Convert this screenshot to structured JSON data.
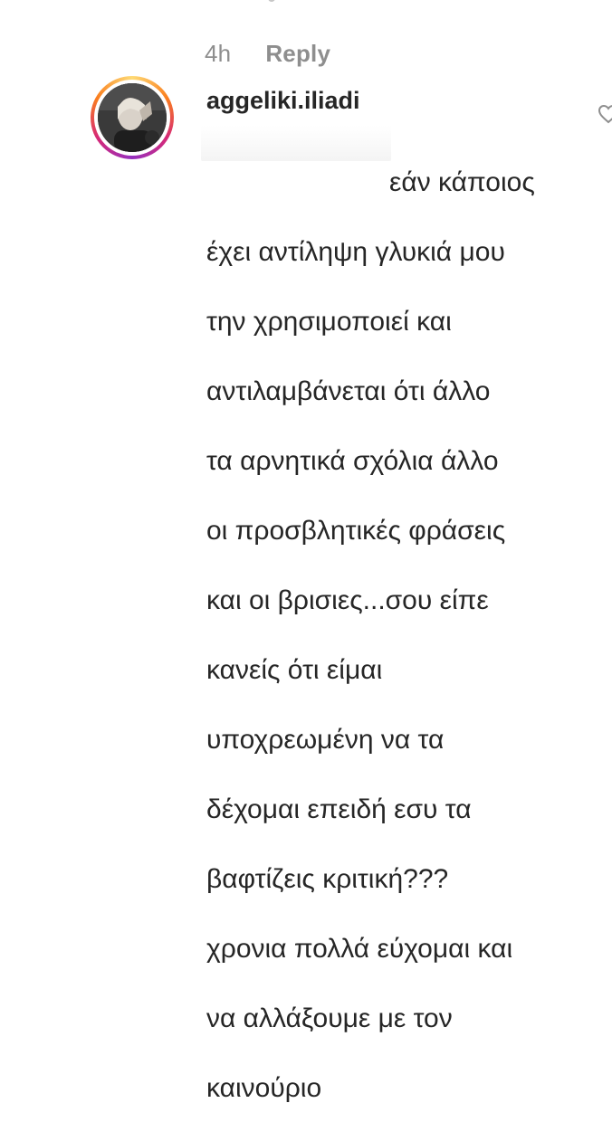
{
  "comment": {
    "timestamp": "4h",
    "reply_label": "Reply",
    "username": "aggeliki.iliadi",
    "text_lines": [
      "εάν κάποιος",
      "έχει αντίληψη γλυκιά μου",
      "την χρησιμοποιεί και",
      "αντιλαμβάνεται ότι άλλο",
      "τα αρνητικά σχόλια άλλο",
      "οι προσβλητικές φράσεις",
      "και οι βρισιες...σου είπε",
      "κανείς ότι είμαι",
      "υποχρεωμένη να τα",
      "δέχομαι επειδή εσυ τα",
      "βαφτίζεις κριτική???",
      "χρονια πολλά εύχομαι και",
      "να αλλάξουμε με τον",
      "καινούριο"
    ]
  },
  "icons": {
    "like": "heart-icon"
  },
  "colors": {
    "text": "#262626",
    "meta": "#8e8e8e",
    "story_ring_start": "#feda75",
    "story_ring_end": "#962fbf"
  }
}
